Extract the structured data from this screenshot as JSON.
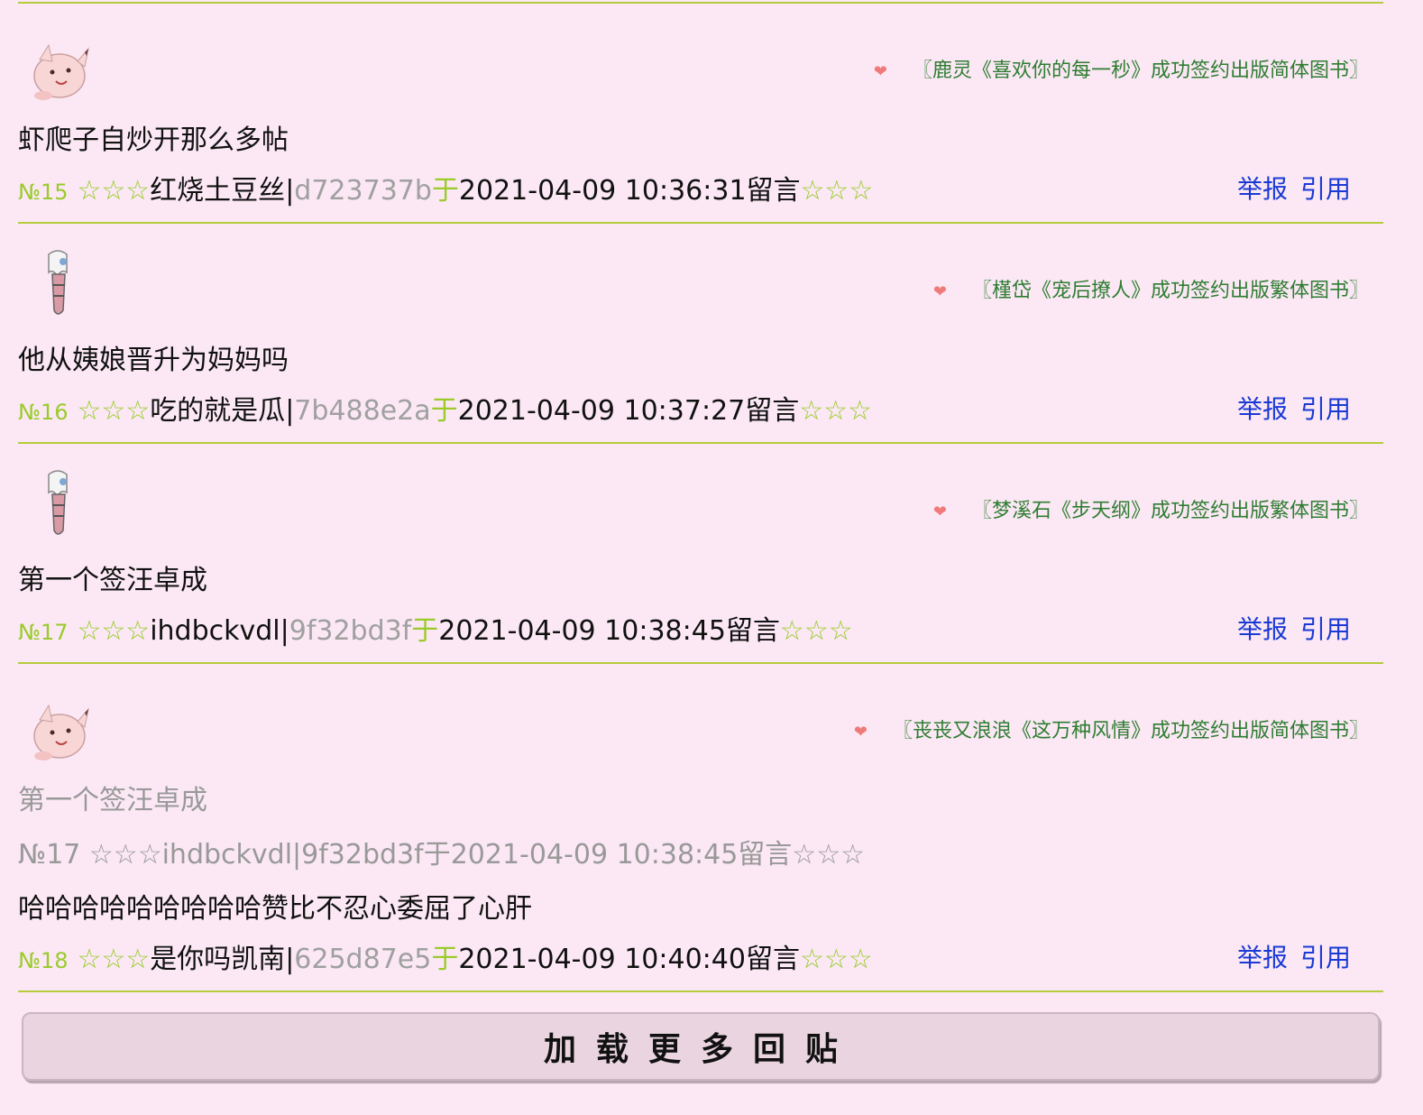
{
  "posts": [
    {
      "avatar": "clefairy-avatar",
      "signature": "〖鹿灵《喜欢你的每一秒》成功签约出版简体图书〗",
      "content": "虾爬子自炒开那么多帖",
      "number": "№15",
      "stars_left": "☆☆☆",
      "author": "红烧土豆丝",
      "sep": "|",
      "uid": "d723737b",
      "at": "于",
      "time": "2021-04-09 10:36:31",
      "suffix": "留言",
      "stars_right": "☆☆☆",
      "report": "举报",
      "quote": "引用"
    },
    {
      "avatar": "ghost-avatar",
      "signature": "〖槿岱《宠后撩人》成功签约出版繁体图书〗",
      "content": "他从姨娘晋升为妈妈吗",
      "number": "№16",
      "stars_left": "☆☆☆",
      "author": "吃的就是瓜",
      "sep": "|",
      "uid": "7b488e2a",
      "at": "于",
      "time": "2021-04-09 10:37:27",
      "suffix": "留言",
      "stars_right": "☆☆☆",
      "report": "举报",
      "quote": "引用"
    },
    {
      "avatar": "ghost-avatar",
      "signature": "〖梦溪石《步天纲》成功签约出版繁体图书〗",
      "content": "第一个签汪卓成",
      "number": "№17",
      "stars_left": "☆☆☆",
      "author": "ihdbckvdl",
      "sep": "|",
      "uid": "9f32bd3f",
      "at": "于",
      "time": "2021-04-09 10:38:45",
      "suffix": "留言",
      "stars_right": "☆☆☆",
      "report": "举报",
      "quote": "引用"
    },
    {
      "avatar": "clefairy-avatar",
      "signature": "〖丧丧又浪浪《这万种风情》成功签约出版简体图书〗",
      "quoted_content": "第一个签汪卓成",
      "quoted_meta": "№17 ☆☆☆ihdbckvdl|9f32bd3f于2021-04-09 10:38:45留言☆☆☆",
      "content": "哈哈哈哈哈哈哈哈哈赞比不忍心委屈了心肝",
      "number": "№18",
      "stars_left": "☆☆☆",
      "author": "是你吗凯南",
      "sep": "|",
      "uid": "625d87e5",
      "at": "于",
      "time": "2021-04-09 10:40:40",
      "suffix": "留言",
      "stars_right": "☆☆☆",
      "report": "举报",
      "quote": "引用"
    }
  ],
  "heart": "❤",
  "load_more": "加载更多回贴",
  "colors": {
    "background": "#fbe8f4",
    "rule": "#b5cc3c",
    "link": "#1a3ad6",
    "signature": "#2e7d32"
  }
}
